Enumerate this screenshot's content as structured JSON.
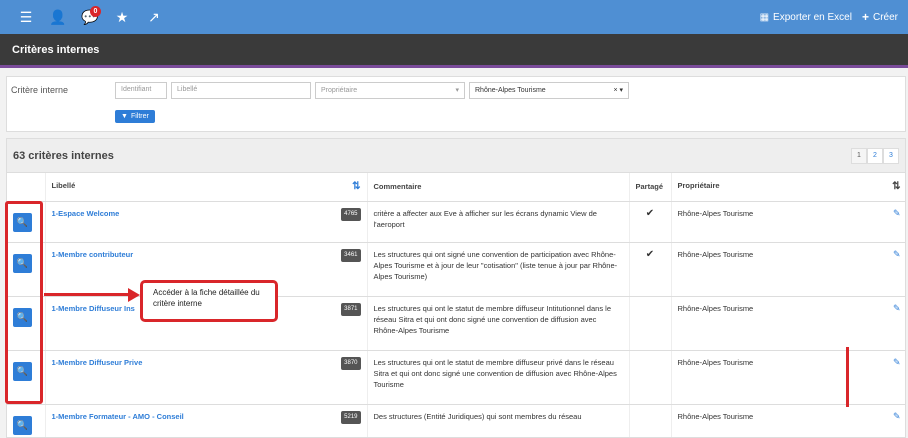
{
  "topbar": {
    "notification_count": "0",
    "export_label": "Exporter en Excel",
    "create_label": "Créer"
  },
  "title": "Critères internes",
  "filters": {
    "label": "Critère interne",
    "identifiant_placeholder": "Identifiant",
    "libelle_placeholder": "Libellé",
    "proprietaire_placeholder": "Propriétaire",
    "selected_owner": "Rhône-Alpes Tourisme",
    "filter_button": "Filtrer"
  },
  "panel": {
    "count": "63 critères internes",
    "pages": [
      "1",
      "2",
      "3"
    ]
  },
  "table": {
    "headers": {
      "libelle": "Libellé",
      "commentaire": "Commentaire",
      "partage": "Partagé",
      "proprietaire": "Propriétaire"
    },
    "rows": [
      {
        "label": "1-Espace Welcome",
        "id": "4765",
        "comment": "critère a affecter aux Eve à afficher sur les écrans dynamic View de l'aeroport",
        "shared": "✔",
        "owner": "Rhône-Alpes Tourisme"
      },
      {
        "label": "1-Membre contributeur",
        "id": "3461",
        "comment": "Les structures qui ont signé une convention de participation avec Rhône-Alpes Tourisme et à jour de leur \"cotisation\" (liste tenue à jour par Rhône-Alpes Tourisme)",
        "shared": "✔",
        "owner": "Rhône-Alpes Tourisme"
      },
      {
        "label": "1-Membre Diffuseur Ins",
        "id": "3871",
        "comment": "Les structures qui ont le statut de membre diffuseur Intitutionnel dans le réseau Sitra et qui ont donc signé une convention de diffusion avec Rhône-Alpes Tourisme",
        "shared": "",
        "owner": "Rhône-Alpes Tourisme"
      },
      {
        "label": "1-Membre Diffuseur Prive",
        "id": "3870",
        "comment": "Les structures qui ont le statut de membre diffuseur privé dans le réseau Sitra et qui ont donc signé une convention de diffusion avec Rhône-Alpes Tourisme",
        "shared": "",
        "owner": "Rhône-Alpes Tourisme"
      },
      {
        "label": "1-Membre Formateur - AMO - Conseil",
        "id": "5219",
        "comment": "Des structures (Entité Juridiques) qui sont membres du réseau",
        "shared": "",
        "owner": "Rhône-Alpes Tourisme"
      }
    ]
  },
  "annotation": {
    "callout_text": "Accéder à la fiche détaillée du critère interne"
  }
}
